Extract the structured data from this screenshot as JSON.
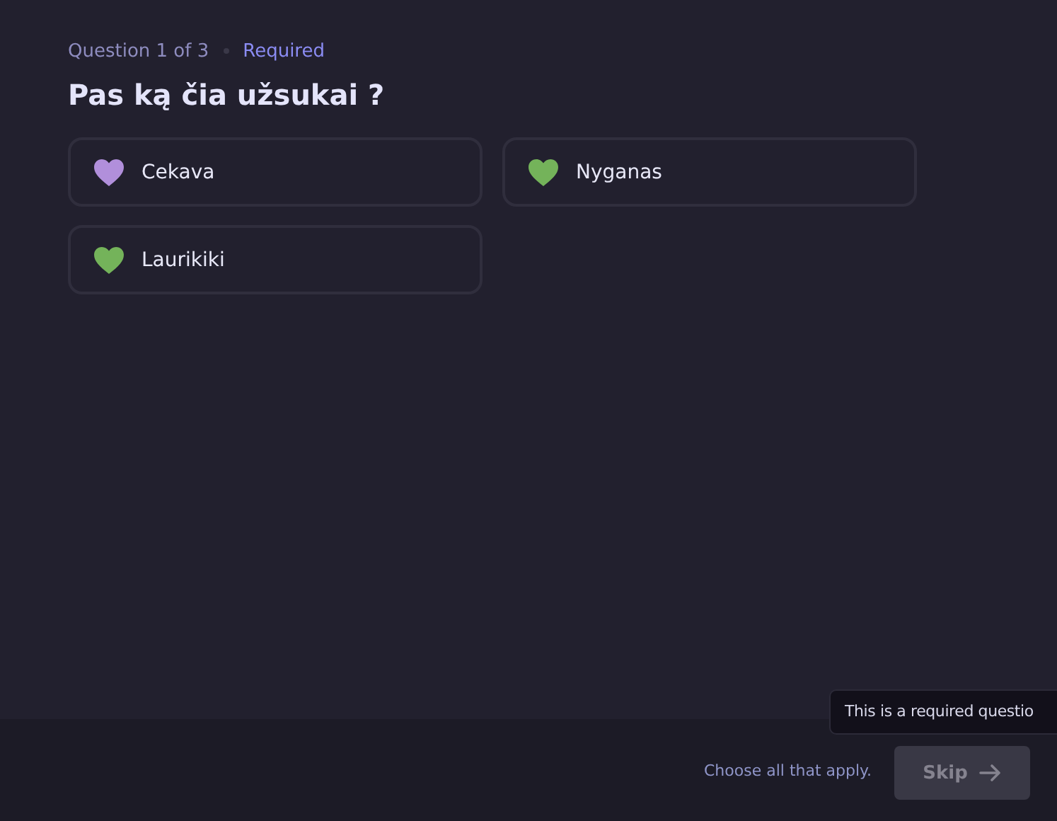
{
  "question": {
    "counter": "Question 1 of 3",
    "required": "Required",
    "title": "Pas ką čia užsukai ?"
  },
  "options": [
    {
      "label": "Cekava",
      "color": "#b18fdb"
    },
    {
      "label": "Nyganas",
      "color": "#74b35a"
    },
    {
      "label": "Laurikiki",
      "color": "#74b35a"
    }
  ],
  "footer": {
    "hint": "Choose all that apply.",
    "button": {
      "label": "Skip",
      "disabled": true
    },
    "tooltip": "This is a required questio"
  }
}
